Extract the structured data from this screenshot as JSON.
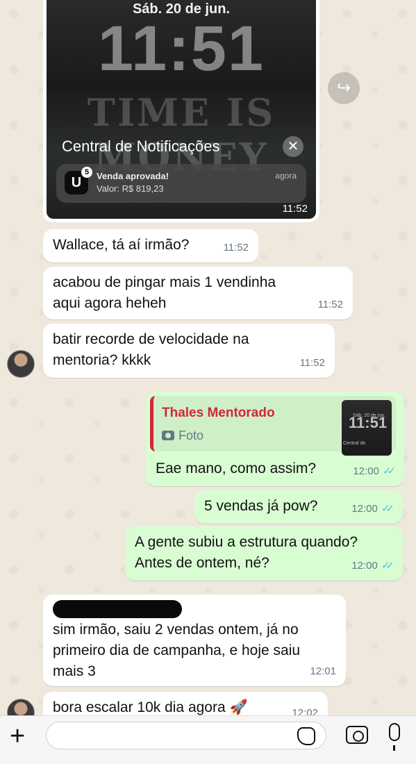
{
  "image_message": {
    "lock_date": "Sáb. 20 de jun.",
    "lock_time": "11:51",
    "wallpaper_text": "TIME IS MONEY",
    "notif_center_title": "Central de Notificações",
    "notif_close": "✕",
    "notif_app_letter": "U",
    "notif_badge": "5",
    "notif_title": "Venda aprovada!",
    "notif_value": "Valor: R$ 819,23",
    "notif_time": "agora",
    "timestamp": "11:52"
  },
  "forward_icon": "↪",
  "messages": [
    {
      "text": "Wallace, tá aí irmão?",
      "time": "11:52"
    },
    {
      "text": "acabou de pingar mais 1 vendinha aqui agora heheh",
      "time": "11:52"
    },
    {
      "text": "batir recorde de velocidade na mentoria? kkkk",
      "time": "11:52"
    },
    {
      "quote_name": "Thales Mentorado",
      "quote_type": "Foto",
      "thumb_date": "Sáb. 20 de jun.",
      "thumb_time": "11:51",
      "thumb_caption": "Central de Notificações",
      "text": "Eae mano, como assim?",
      "time": "12:00"
    },
    {
      "text": "5 vendas já pow?",
      "time": "12:00"
    },
    {
      "text": "A gente subiu a estrutura quando? Antes de ontem, né?",
      "time": "12:00"
    },
    {
      "text": "sim irmão, saiu 2 vendas ontem, já no primeiro dia de campanha, e hoje saiu mais 3",
      "time": "12:01"
    },
    {
      "text": "bora escalar 10k dia agora 🚀",
      "time": "12:02"
    }
  ],
  "ticks": "✓✓",
  "composer": {
    "plus": "+",
    "value": ""
  }
}
